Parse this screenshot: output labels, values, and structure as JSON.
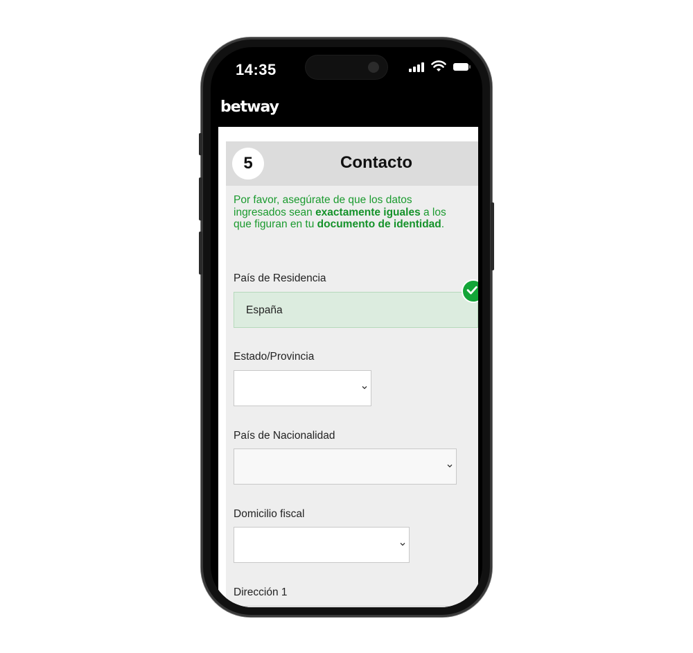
{
  "status_bar": {
    "time": "14:35"
  },
  "brand": {
    "logo_text": "betway"
  },
  "step": {
    "number": "5",
    "title": "Contacto"
  },
  "notice": {
    "part1": "Por favor, asegúrate de que los datos ingresados sean ",
    "bold1": "exactamente iguales",
    "part2": " a los que figuran en tu ",
    "bold2": "documento de identidad",
    "part3": "."
  },
  "fields": {
    "country_residence": {
      "label": "País de Residencia",
      "value": "España",
      "validated": true
    },
    "state_province": {
      "label": "Estado/Provincia",
      "value": ""
    },
    "nationality": {
      "label": "País de Nacionalidad",
      "value": ""
    },
    "fiscal_address": {
      "label": "Domicilio fiscal",
      "value": ""
    },
    "address1": {
      "label": "Dirección 1",
      "value": ""
    }
  },
  "colors": {
    "accent_green": "#1a9a2e",
    "check_green": "#13a538",
    "valid_field_bg": "#dcecdf"
  },
  "icons": [
    "signal-icon",
    "wifi-icon",
    "battery-icon",
    "check-icon",
    "chevron-down-icon"
  ]
}
